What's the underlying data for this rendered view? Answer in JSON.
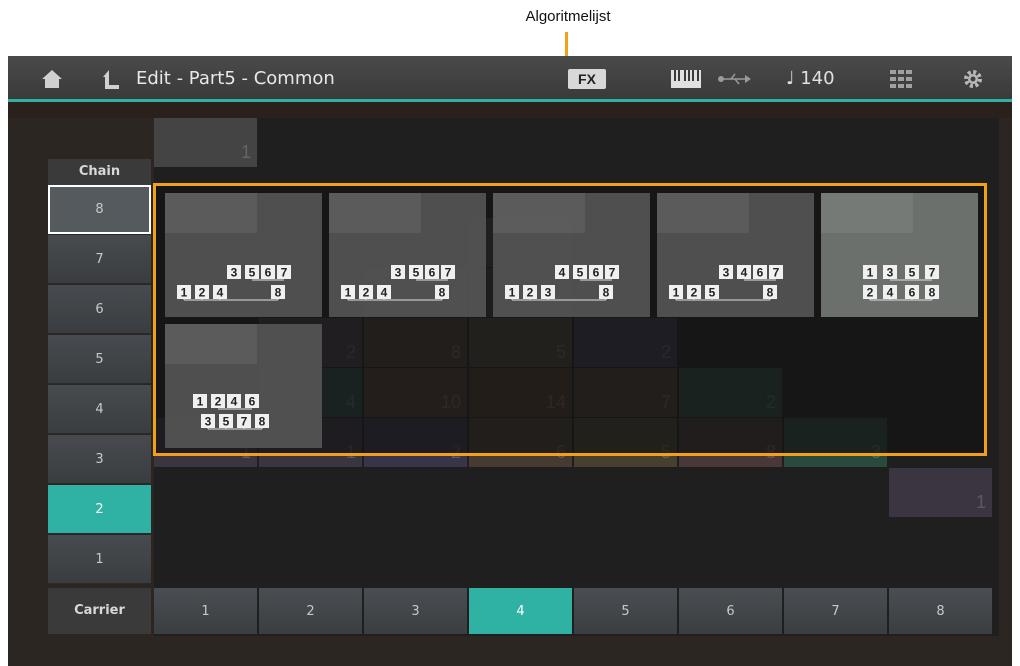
{
  "annotation": {
    "label": "Algoritmelijst"
  },
  "header": {
    "title": "Edit - Part5 - Common",
    "fx_label": "FX",
    "tempo": "♩ 140",
    "icons": [
      "home-icon",
      "back-icon",
      "keyboard-icon",
      "usb-icon",
      "grid-icon",
      "gear-icon"
    ]
  },
  "chain": {
    "header": "Chain",
    "items": [
      "8",
      "7",
      "6",
      "5",
      "4",
      "3",
      "2",
      "1"
    ],
    "selected": "2",
    "focused": "8"
  },
  "carrier": {
    "header": "Carrier",
    "items": [
      "1",
      "2",
      "3",
      "4",
      "5",
      "6",
      "7",
      "8"
    ],
    "selected": "4"
  },
  "grid_numbers": [
    "1",
    "1",
    "4",
    "1",
    "2",
    "8",
    "5",
    "2",
    "4",
    "10",
    "14",
    "7",
    "2",
    "1",
    "1",
    "2",
    "6",
    "5",
    "8",
    "3",
    "1"
  ],
  "algorithms": [
    {
      "top": [
        "3",
        "5",
        "6",
        "7"
      ],
      "bottom": [
        "1",
        "2",
        "4",
        "8"
      ]
    },
    {
      "top": [
        "3",
        "5",
        "6",
        "7"
      ],
      "bottom": [
        "1",
        "2",
        "4",
        "8"
      ]
    },
    {
      "top": [
        "4",
        "5",
        "6",
        "7"
      ],
      "bottom": [
        "1",
        "2",
        "3",
        "8"
      ]
    },
    {
      "top": [
        "3",
        "4",
        "6",
        "7"
      ],
      "bottom": [
        "1",
        "2",
        "5",
        "8"
      ]
    },
    {
      "top": [
        "1",
        "3",
        "5",
        "7"
      ],
      "bottom": [
        "2",
        "4",
        "6",
        "8"
      ]
    },
    {
      "top": [
        "1",
        "2",
        "4",
        "6"
      ],
      "bottom": [
        "3",
        "5",
        "7",
        "8"
      ]
    }
  ],
  "colors": {
    "accent": "#2fb1a4",
    "highlight": "#f2a018"
  }
}
